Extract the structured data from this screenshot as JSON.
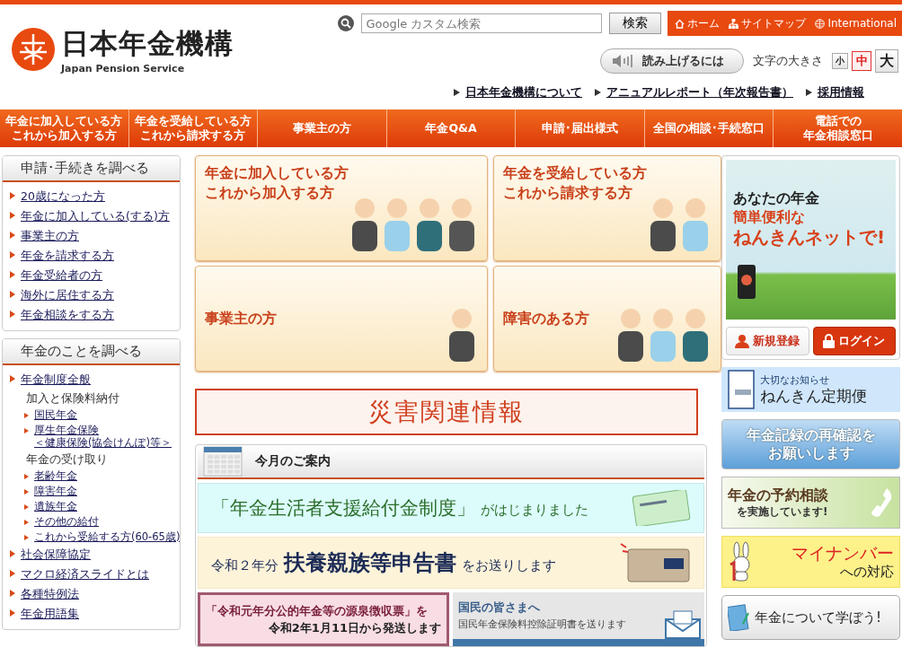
{
  "header": {
    "logo": {
      "title": "日本年金機構",
      "subtitle": "Japan Pension Service"
    },
    "search": {
      "placeholder": "Google カスタム検索",
      "button": "検索"
    },
    "top_links": [
      {
        "label": "ホーム",
        "kind": "home"
      },
      {
        "label": "サイトマップ",
        "kind": "sitemap"
      },
      {
        "label": "International",
        "kind": "globe"
      }
    ],
    "read_aloud": "読み上げるには",
    "font_size": {
      "label": "文字の大きさ",
      "options": [
        {
          "label": "小",
          "selected": false
        },
        {
          "label": "中",
          "selected": true
        },
        {
          "label": "大",
          "selected": false
        }
      ]
    },
    "sub_links": [
      "日本年金機構について",
      "アニュアルレポート（年次報告書）",
      "採用情報"
    ]
  },
  "nav": [
    {
      "lines": [
        "年金に加入している方",
        "これから加入する方"
      ]
    },
    {
      "lines": [
        "年金を受給している方",
        "これから請求する方"
      ]
    },
    {
      "lines": [
        "事業主の方"
      ]
    },
    {
      "lines": [
        "年金Q&A"
      ]
    },
    {
      "lines": [
        "申請･届出様式"
      ]
    },
    {
      "lines": [
        "全国の相談･手続窓口"
      ]
    },
    {
      "lines": [
        "電話での",
        "年金相談窓口"
      ]
    }
  ],
  "sidebar": [
    {
      "title": "申請･手続きを調べる",
      "items": [
        {
          "kind": "link",
          "label": "20歳になった方"
        },
        {
          "kind": "link",
          "label": "年金に加入している(する)方"
        },
        {
          "kind": "link",
          "label": "事業主の方"
        },
        {
          "kind": "link",
          "label": "年金を請求する方"
        },
        {
          "kind": "link",
          "label": "年金受給者の方"
        },
        {
          "kind": "link",
          "label": "海外に居住する方"
        },
        {
          "kind": "link",
          "label": "年金相談をする方"
        }
      ]
    },
    {
      "title": "年金のことを調べる",
      "items": [
        {
          "kind": "link",
          "label": "年金制度全般"
        },
        {
          "kind": "heading",
          "label": "加入と保険料納付",
          "children": [
            {
              "lines": [
                "国民年金"
              ]
            },
            {
              "lines": [
                "厚生年金保険",
                "＜健康保険(協会けんぽ)等＞"
              ]
            }
          ]
        },
        {
          "kind": "heading",
          "label": "年金の受け取り",
          "children": [
            {
              "lines": [
                "老齢年金"
              ]
            },
            {
              "lines": [
                "障害年金"
              ]
            },
            {
              "lines": [
                "遺族年金"
              ]
            },
            {
              "lines": [
                "その他の給付"
              ]
            },
            {
              "lines": [
                "これから受給する方(60-65歳)"
              ]
            }
          ]
        },
        {
          "kind": "link",
          "label": "社会保障協定"
        },
        {
          "kind": "link",
          "label": "マクロ経済スライドとは"
        },
        {
          "kind": "link",
          "label": "各種特例法"
        },
        {
          "kind": "link",
          "label": "年金用語集"
        }
      ]
    }
  ],
  "feature_cards": [
    {
      "lines": [
        "年金に加入している方",
        "これから加入する方"
      ]
    },
    {
      "lines": [
        "年金を受給している方",
        "これから請求する方"
      ]
    },
    {
      "lines": [
        "事業主の方"
      ]
    },
    {
      "lines": [
        "障害のある方"
      ]
    }
  ],
  "disaster_banner": "災害関連情報",
  "monthly": {
    "title": "今月のご案内",
    "banners": [
      {
        "kind": "benefit",
        "main": "「年金生活者支援給付金制度」",
        "tail": "がはじまりました"
      },
      {
        "kind": "dependents",
        "lead": "令和２年分",
        "main": "扶養親族等申告書",
        "tail": "をお送りします"
      }
    ],
    "small_banners": [
      {
        "kind": "withholding",
        "lines": [
          "「令和元年分公的年金等の源泉徴収票」を",
          "令和2年1月11日から発送します"
        ]
      },
      {
        "kind": "notice",
        "lines": [
          "国民の皆さまへ",
          "国民年金保険料控除証明書を送ります"
        ]
      }
    ]
  },
  "right": {
    "nenkin_net": {
      "lines": [
        "あなたの年金",
        "簡単便利な",
        "ねんきんネットで!"
      ],
      "register": "新規登録",
      "login": "ログイン"
    },
    "banners": [
      {
        "kind": "teikibin",
        "lines": [
          "大切なお知らせ",
          "ねんきん定期便"
        ]
      },
      {
        "kind": "records",
        "lines": [
          "年金記録の再確認を",
          "お願いします"
        ]
      },
      {
        "kind": "consult",
        "lines": [
          "年金の予約相談",
          "を実施しています!"
        ]
      },
      {
        "kind": "mynumber",
        "lines": [
          "マイナンバー",
          "への対応"
        ]
      },
      {
        "kind": "learn",
        "lines": [
          "年金について学ぼう!"
        ]
      }
    ]
  }
}
